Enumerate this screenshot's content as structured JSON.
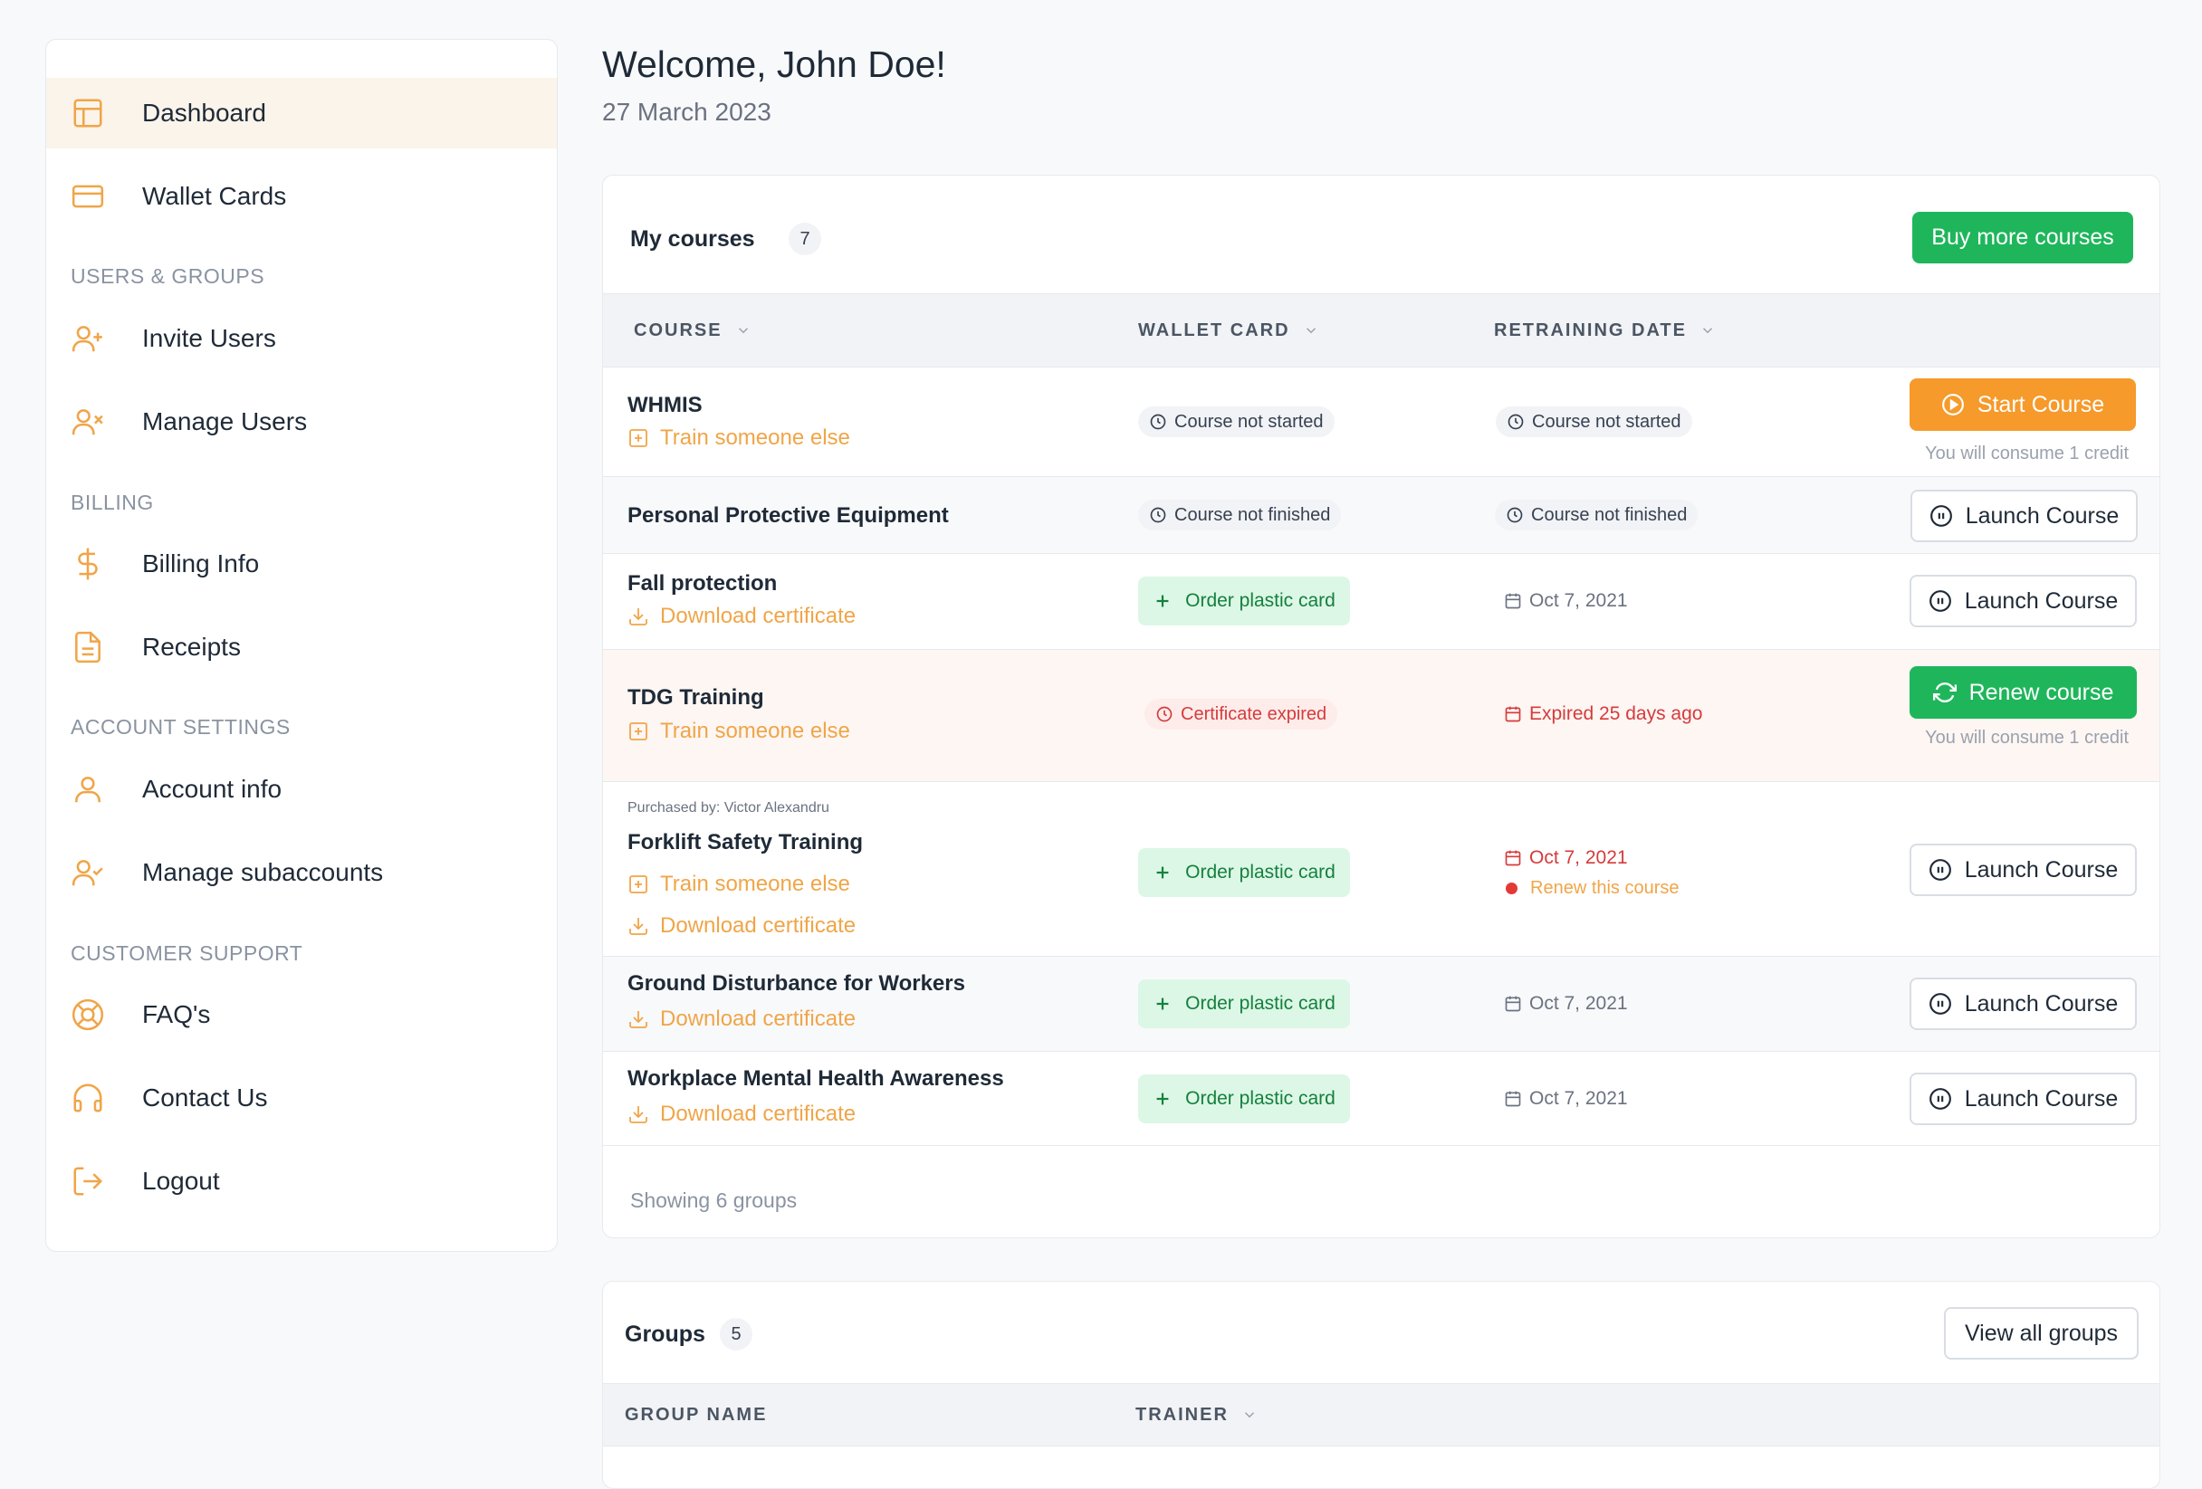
{
  "sidebar": {
    "items": [
      {
        "label": "Dashboard",
        "icon": "layout-icon"
      },
      {
        "label": "Wallet Cards",
        "icon": "credit-card-icon"
      },
      {
        "label": "Invite Users",
        "icon": "user-plus-icon"
      },
      {
        "label": "Manage Users",
        "icon": "user-x-icon"
      },
      {
        "label": "Billing Info",
        "icon": "dollar-icon"
      },
      {
        "label": "Receipts",
        "icon": "file-text-icon"
      },
      {
        "label": "Account info",
        "icon": "user-icon"
      },
      {
        "label": "Manage subaccounts",
        "icon": "user-check-icon"
      },
      {
        "label": "FAQ's",
        "icon": "life-buoy-icon"
      },
      {
        "label": "Contact Us",
        "icon": "headphones-icon"
      },
      {
        "label": "Logout",
        "icon": "log-out-icon"
      }
    ],
    "sections": {
      "users": "USERS & GROUPS",
      "billing": "BILLING",
      "account": "ACCOUNT SETTINGS",
      "support": "CUSTOMER SUPPORT"
    },
    "accent_color": "#f0a548"
  },
  "header": {
    "welcome": "Welcome, John Doe!",
    "date": "27 March 2023"
  },
  "courses": {
    "title": "My courses",
    "count": "7",
    "buy_button": "Buy more courses",
    "columns": [
      "COURSE",
      "WALLET CARD",
      "RETRAINING DATE"
    ],
    "rows": [
      {
        "name": "WHMIS",
        "link1": "Train someone else",
        "wallet": "Course not started",
        "retraining": "Course not started",
        "action": "Start Course",
        "note": "You will consume 1 credit"
      },
      {
        "name": "Personal Protective Equipment",
        "wallet": "Course not finished",
        "retraining": "Course not finished",
        "action": "Launch Course"
      },
      {
        "name": "Fall protection",
        "link1": "Download certificate",
        "wallet": "Order plastic card",
        "retraining": "Oct 7, 2021",
        "action": "Launch Course"
      },
      {
        "name": "TDG Training",
        "link1": "Train someone else",
        "wallet": "Certificate expired",
        "retraining": "Expired 25 days ago",
        "action": "Renew course",
        "note": "You will consume 1 credit"
      },
      {
        "purchased": "Purchased by: Victor Alexandru",
        "name": "Forklift Safety Training",
        "link1": "Train someone else",
        "link2": "Download certificate",
        "wallet": "Order plastic card",
        "retraining": "Oct 7, 2021",
        "renew": "Renew this course",
        "action": "Launch Course"
      },
      {
        "name": "Ground Disturbance for Workers",
        "link1": "Download certificate",
        "wallet": "Order plastic card",
        "retraining": "Oct 7, 2021",
        "action": "Launch Course"
      },
      {
        "name": "Workplace Mental Health Awareness",
        "link1": "Download certificate",
        "wallet": "Order plastic card",
        "retraining": "Oct 7, 2021",
        "action": "Launch Course"
      }
    ],
    "footer": "Showing 6 groups"
  },
  "groups": {
    "title": "Groups",
    "count": "5",
    "view_all": "View all groups",
    "columns": [
      "GROUP NAME",
      "TRAINER"
    ]
  },
  "colors": {
    "green": "#1fb65b",
    "orange": "#f59a2b",
    "red": "#d63b3b"
  }
}
